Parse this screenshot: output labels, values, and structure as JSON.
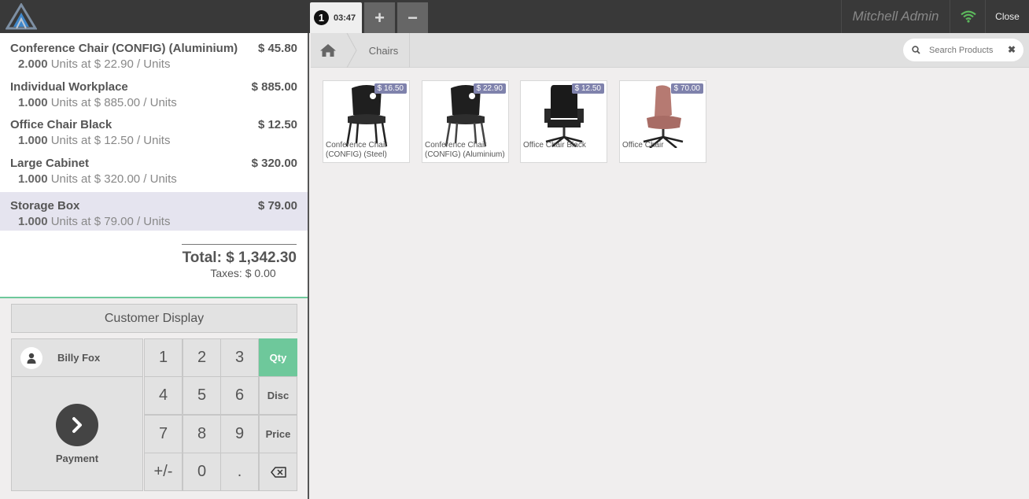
{
  "topbar": {
    "order_number": "1",
    "order_time": "03:47",
    "add_order": "+",
    "remove_order": "−",
    "user_name": "Mitchell Admin",
    "close_label": "Close"
  },
  "orderlines": [
    {
      "name": "Conference Chair (CONFIG) (Aluminium)",
      "price": "$ 45.80",
      "qty": "2.000",
      "info": " Units at $ 22.90 / Units"
    },
    {
      "name": "Individual Workplace",
      "price": "$ 885.00",
      "qty": "1.000",
      "info": " Units at $ 885.00 / Units"
    },
    {
      "name": "Office Chair Black",
      "price": "$ 12.50",
      "qty": "1.000",
      "info": " Units at $ 12.50 / Units"
    },
    {
      "name": "Large Cabinet",
      "price": "$ 320.00",
      "qty": "1.000",
      "info": " Units at $ 320.00 / Units"
    },
    {
      "name": "Storage Box",
      "price": "$ 79.00",
      "qty": "1.000",
      "info": " Units at $ 79.00 / Units"
    }
  ],
  "summary": {
    "total": "Total: $ 1,342.30",
    "taxes": "Taxes: $ 0.00"
  },
  "controls": {
    "customer_display": "Customer Display",
    "customer_name": "Billy Fox",
    "payment_label": "Payment",
    "keys": [
      "1",
      "2",
      "3",
      "4",
      "5",
      "6",
      "7",
      "8",
      "9",
      "+/-",
      "0",
      "."
    ],
    "modes": [
      "Qty",
      "Disc",
      "Price"
    ],
    "active_mode": "Qty"
  },
  "breadcrumb": {
    "category": "Chairs"
  },
  "search": {
    "placeholder": "Search Products"
  },
  "products": [
    {
      "name": "Conference Chair (CONFIG) (Steel)",
      "price": "$ 16.50"
    },
    {
      "name": "Conference Chair (CONFIG) (Aluminium)",
      "price": "$ 22.90"
    },
    {
      "name": "Office Chair Black",
      "price": "$ 12.50"
    },
    {
      "name": "Office Chair",
      "price": "$ 70.00"
    }
  ],
  "colors": {
    "accent_green": "#6ec89b",
    "price_tag": "#7f82ac",
    "wifi_green": "#5cb85c",
    "topbar": "#393939"
  }
}
